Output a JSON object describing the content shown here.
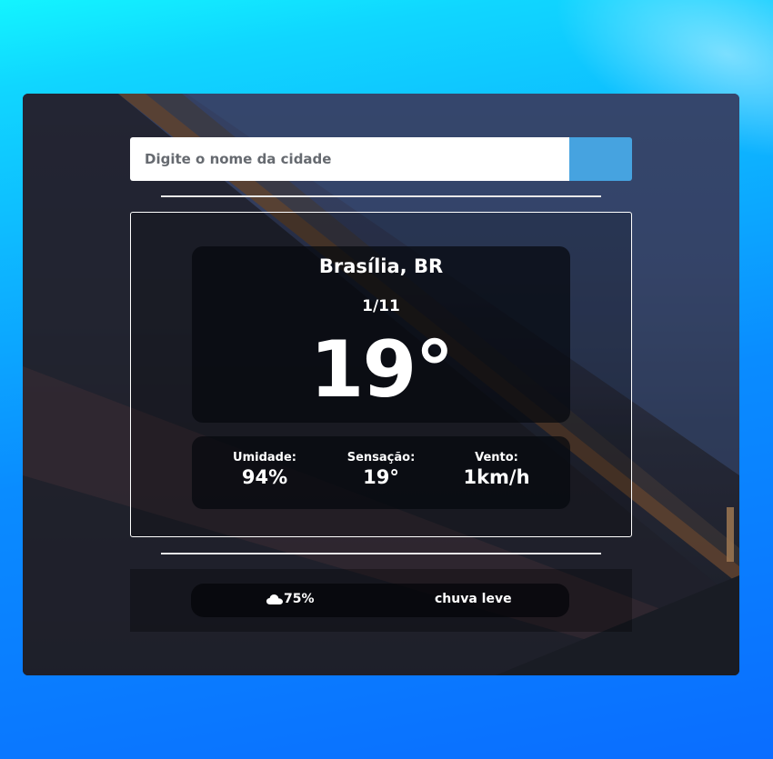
{
  "search": {
    "placeholder": "Digite o nome da cidade",
    "button_icon": "search-icon"
  },
  "weather": {
    "city": "Brasília, BR",
    "date": "1/11",
    "temperature": "19°",
    "stats": [
      {
        "label": "Umidade:",
        "value": "94%"
      },
      {
        "label": "Sensação:",
        "value": "19°"
      },
      {
        "label": "Vento:",
        "value": "1km/h"
      }
    ]
  },
  "footer": {
    "cloud_icon": "cloud-icon",
    "cloudiness": "75%",
    "description": "chuva leve"
  },
  "colors": {
    "search_button": "#46a3e0",
    "page_top": "#13f4ff",
    "page_bottom": "#0a6dff"
  }
}
